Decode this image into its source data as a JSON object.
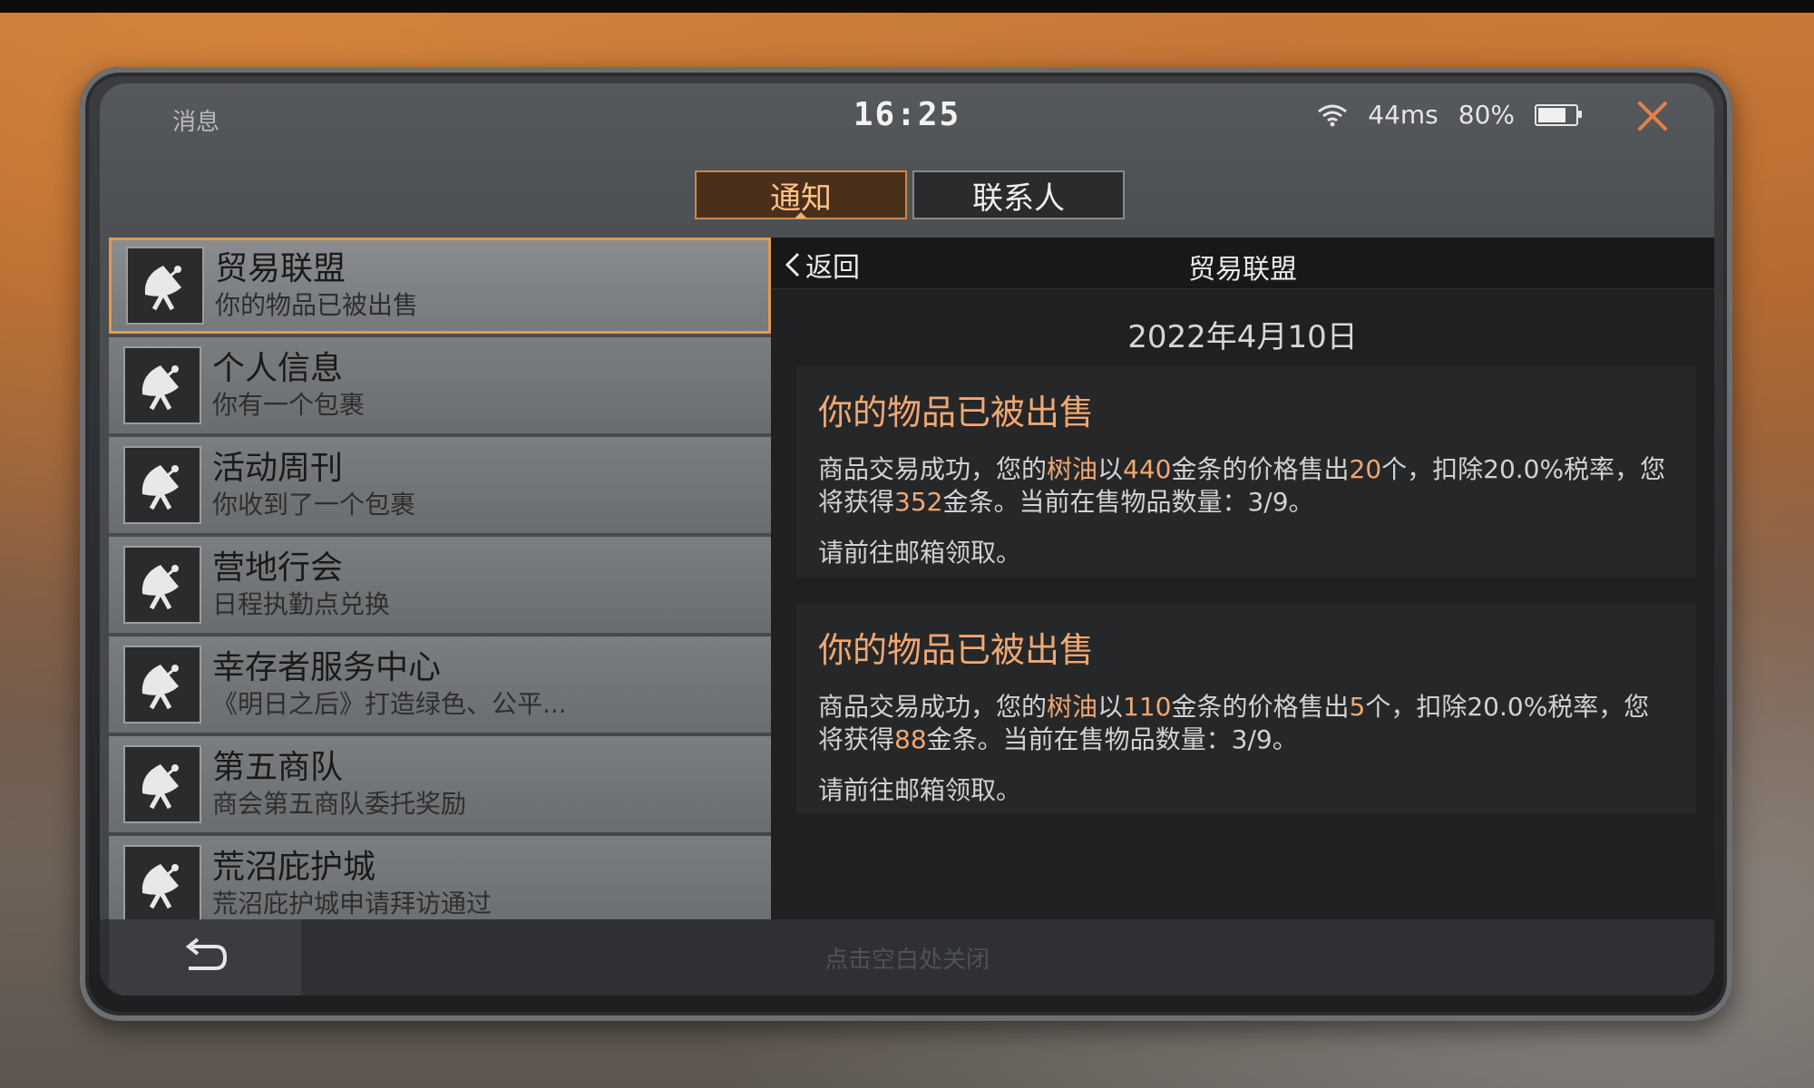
{
  "header": {
    "title": "消息",
    "time": "16:25",
    "ping": "44ms",
    "battery": "80%",
    "battery_level": 0.8,
    "close_icon": "close-x-icon"
  },
  "tabs": [
    {
      "label": "通知",
      "active": true
    },
    {
      "label": "联系人",
      "active": false
    }
  ],
  "list": [
    {
      "title": "贸易联盟",
      "subtitle": "你的物品已被出售",
      "selected": true
    },
    {
      "title": "个人信息",
      "subtitle": "你有一个包裹"
    },
    {
      "title": "活动周刊",
      "subtitle": "你收到了一个包裹"
    },
    {
      "title": "营地行会",
      "subtitle": "日程执勤点兑换"
    },
    {
      "title": "幸存者服务中心",
      "subtitle": "《明日之后》打造绿色、公平..."
    },
    {
      "title": "第五商队",
      "subtitle": "商会第五商队委托奖励"
    },
    {
      "title": "荒沼庇护城",
      "subtitle": "荒沼庇护城申请拜访通过"
    }
  ],
  "detail": {
    "back_label": "返回",
    "title": "贸易联盟",
    "date": "2022年4月10日",
    "messages": [
      {
        "title": "你的物品已被出售",
        "p1": "商品交易成功，您的",
        "item": "树油",
        "p2": "以",
        "price": "440",
        "p3": "金条的价格售出",
        "count": "20",
        "p4": "个，扣除20.0%税率，您将获得",
        "gain": "352",
        "p5": "金条。当前在售物品数量：3/9。",
        "footer": "请前往邮箱领取。"
      },
      {
        "title": "你的物品已被出售",
        "p1": "商品交易成功，您的",
        "item": "树油",
        "p2": "以",
        "price": "110",
        "p3": "金条的价格售出",
        "count": "5",
        "p4": "个，扣除20.0%税率，您将获得",
        "gain": "88",
        "p5": "金条。当前在售物品数量：3/9。",
        "footer": "请前往邮箱领取。"
      }
    ]
  },
  "bottom": {
    "hint": "点击空白处关闭",
    "undo_icon": "undo-arrow-icon"
  },
  "colors": {
    "accent": "#e29a4f",
    "highlight_text": "#f0a872"
  }
}
